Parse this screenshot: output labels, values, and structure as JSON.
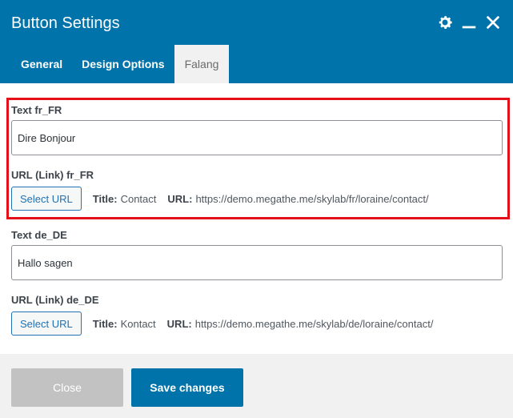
{
  "dialog": {
    "title": "Button Settings",
    "icons": [
      "gear-icon",
      "minimize-icon",
      "close-icon"
    ]
  },
  "tabs": [
    {
      "label": "General",
      "active": false
    },
    {
      "label": "Design Options",
      "active": false
    },
    {
      "label": "Falang",
      "active": true
    }
  ],
  "fields": {
    "fr": {
      "text_label": "Text fr_FR",
      "text_value": "Dire Bonjour",
      "url_label": "URL (Link) fr_FR",
      "select_label": "Select URL",
      "title_key": "Title:",
      "title_value": "Contact",
      "url_key": "URL:",
      "url_value": "https://demo.megathe.me/skylab/fr/loraine/contact/"
    },
    "de": {
      "text_label": "Text de_DE",
      "text_value": "Hallo sagen",
      "url_label": "URL (Link) de_DE",
      "select_label": "Select URL",
      "title_key": "Title:",
      "title_value": "Kontact",
      "url_key": "URL:",
      "url_value": "https://demo.megathe.me/skylab/de/loraine/contact/"
    }
  },
  "footer": {
    "close_label": "Close",
    "save_label": "Save changes"
  },
  "colors": {
    "header": "#0073aa",
    "highlight": "#e3101a",
    "close_button": "#c2c2c2",
    "save_button": "#0073aa"
  }
}
